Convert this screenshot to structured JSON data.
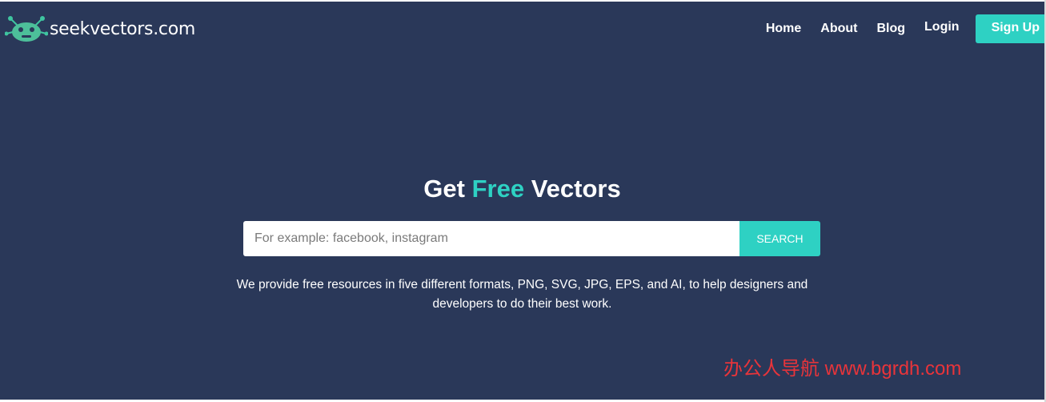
{
  "brand": {
    "name": "seekvectors.com",
    "logo_icon": "robot-icon",
    "accent_color": "#2ed1c3",
    "background_color": "#2a3859"
  },
  "nav": {
    "home": "Home",
    "about": "About",
    "blog": "Blog",
    "login": "Login",
    "signup": "Sign Up"
  },
  "hero": {
    "title_pre": "Get ",
    "title_accent": "Free",
    "title_post": " Vectors",
    "search_placeholder": "For example: facebook, instagram",
    "search_value": "",
    "search_button": "SEARCH",
    "description_line1": "We provide free resources in five different formats, PNG, SVG, JPG, EPS, and AI, to help designers and",
    "description_line2": "developers to do their best work."
  },
  "watermark": {
    "text": "办公人导航  www.bgrdh.com",
    "color": "#e8343a"
  }
}
